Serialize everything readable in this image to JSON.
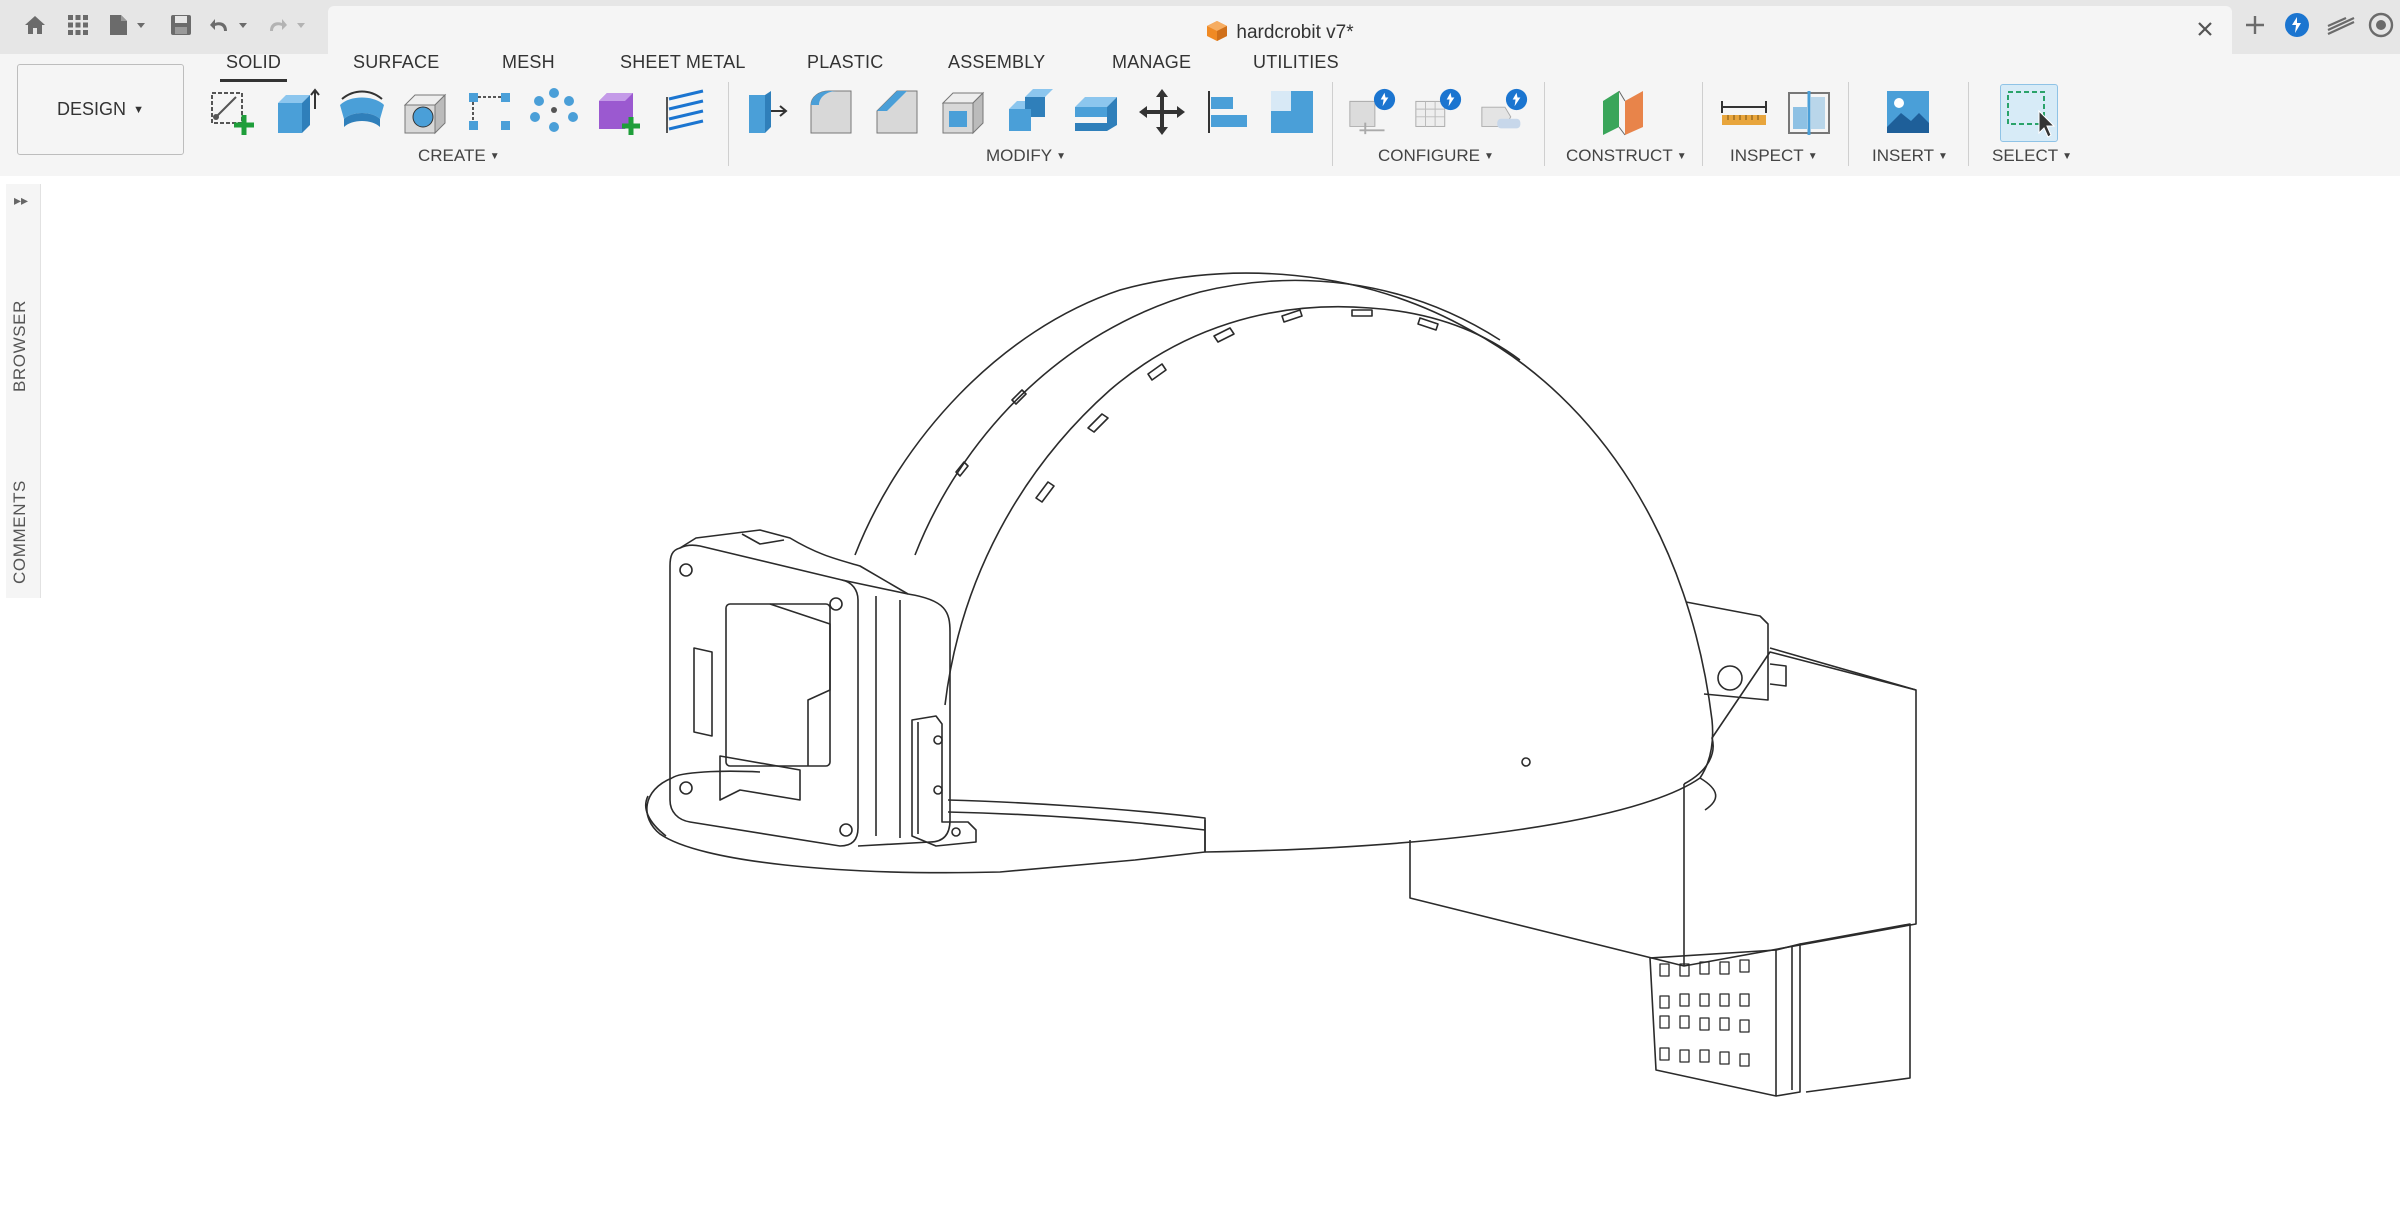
{
  "window": {
    "title": "hardcrobit v7*"
  },
  "workspace": {
    "label": "DESIGN"
  },
  "tabs": [
    {
      "label": "SOLID",
      "active": true
    },
    {
      "label": "SURFACE",
      "active": false
    },
    {
      "label": "MESH",
      "active": false
    },
    {
      "label": "SHEET METAL",
      "active": false
    },
    {
      "label": "PLASTIC",
      "active": false
    },
    {
      "label": "ASSEMBLY",
      "active": false
    },
    {
      "label": "MANAGE",
      "active": false
    },
    {
      "label": "UTILITIES",
      "active": false
    }
  ],
  "groups": {
    "create": "CREATE",
    "modify": "MODIFY",
    "configure": "CONFIGURE",
    "construct": "CONSTRUCT",
    "inspect": "INSPECT",
    "insert": "INSERT",
    "select": "SELECT"
  },
  "side_panel": {
    "browser": "BROWSER",
    "comments": "COMMENTS"
  },
  "colors": {
    "accent_blue": "#1b75d0",
    "tool_blue": "#4a9fd8",
    "title_bar": "#e6e6e6",
    "toolbar": "#f5f5f5"
  }
}
